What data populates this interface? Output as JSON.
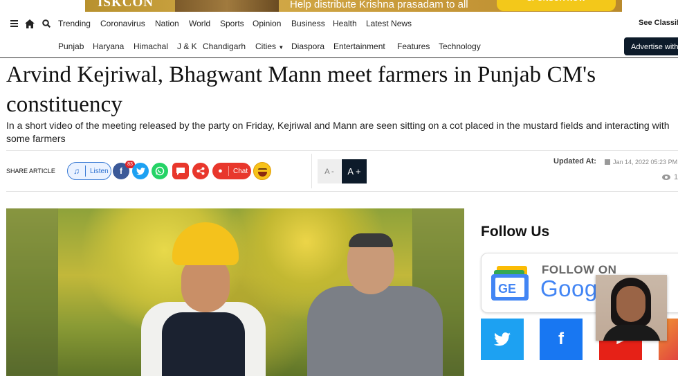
{
  "ad": {
    "logo": "ISKCON",
    "text": "Help distribute Krishna prasadam to all",
    "cta": "SPONSOR NOW"
  },
  "nav": {
    "primary": [
      "Trending",
      "Coronavirus",
      "Nation",
      "World",
      "Sports",
      "Opinion",
      "Business",
      "Health",
      "Latest News"
    ],
    "secondary": [
      "Punjab",
      "Haryana",
      "Himachal",
      "J & K",
      "Chandigarh",
      "Cities",
      "Diaspora",
      "Entertainment",
      "Features",
      "Technology"
    ],
    "see_classifieds": "See Classifieds",
    "advertise": "Advertise with us"
  },
  "article": {
    "title": "Arvind Kejriwal, Bhagwant Mann meet farmers in Punjab CM's constituency",
    "summary": "In a short video of the meeting released by the party on Friday, Kejriwal and Mann are seen sitting on a cot placed in the mustard fields and interacting with some farmers"
  },
  "share": {
    "label": "SHARE ARTICLE",
    "listen": "Listen",
    "fb_count": "83",
    "chat": "Chat",
    "font_minus": "A -",
    "font_plus": "A +",
    "updated_label": "Updated At:",
    "updated_value": "Jan 14, 2022 05:23 PM",
    "views": "1"
  },
  "sidebar": {
    "follow_title": "Follow Us",
    "gnews_follow": "FOLLOW ON",
    "gnews_google": "Google"
  },
  "colors": {
    "twitter": "#1da1f2",
    "facebook": "#1877f2",
    "youtube": "#e62117",
    "instagram": "#f09433",
    "whatsapp": "#25d366",
    "nav_dark": "#0d1b2a"
  }
}
